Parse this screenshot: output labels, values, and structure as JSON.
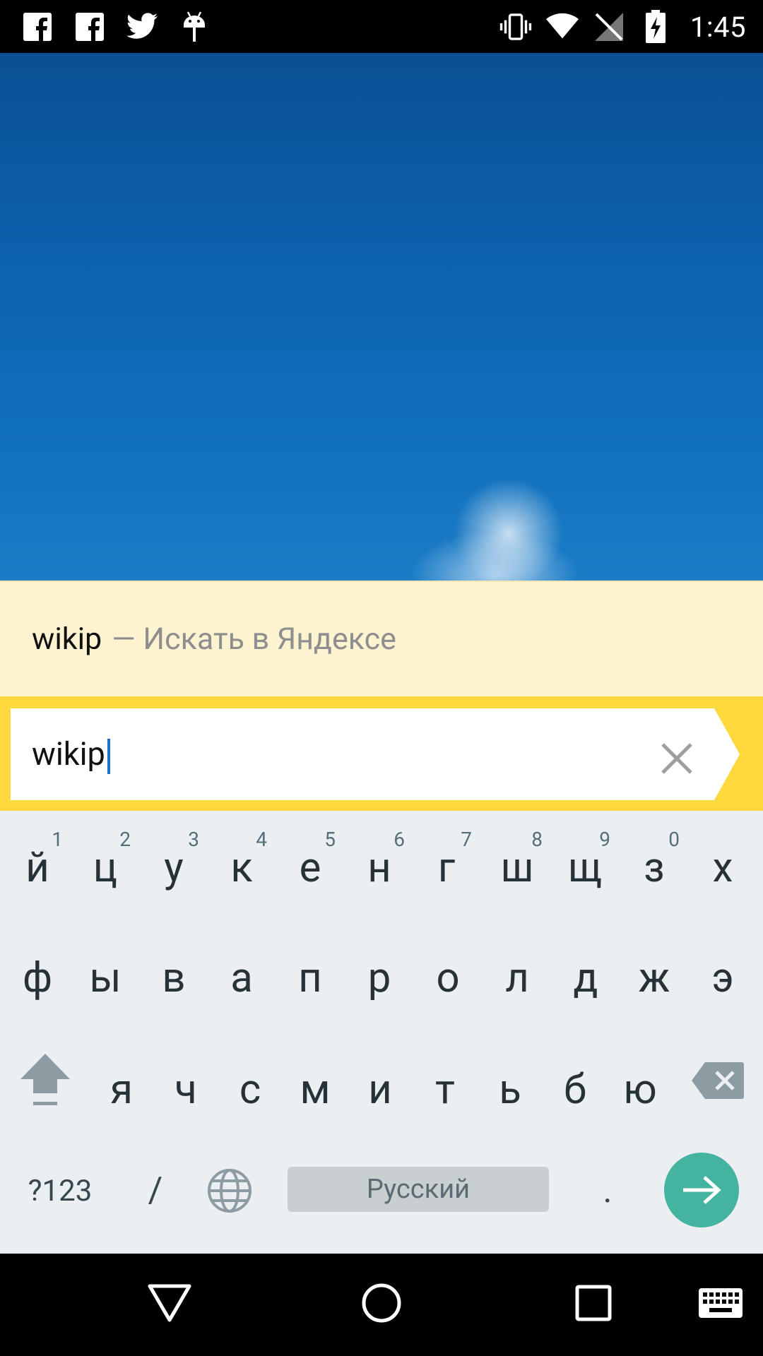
{
  "status_bar": {
    "time": "1:45",
    "left_icons": [
      "facebook-icon",
      "facebook-icon",
      "twitter-icon",
      "android-icon"
    ],
    "right_icons": [
      "vibrate-icon",
      "wifi-icon",
      "no-signal-icon",
      "battery-charging-icon"
    ]
  },
  "suggestion": {
    "query": "wikip",
    "hint": "— Искать в Яндексе"
  },
  "search": {
    "value": "wikip",
    "clear_icon": "close-icon"
  },
  "keyboard": {
    "row1": [
      {
        "ch": "й",
        "num": "1"
      },
      {
        "ch": "ц",
        "num": "2"
      },
      {
        "ch": "у",
        "num": "3"
      },
      {
        "ch": "к",
        "num": "4"
      },
      {
        "ch": "е",
        "num": "5"
      },
      {
        "ch": "н",
        "num": "6"
      },
      {
        "ch": "г",
        "num": "7"
      },
      {
        "ch": "ш",
        "num": "8"
      },
      {
        "ch": "щ",
        "num": "9"
      },
      {
        "ch": "з",
        "num": "0"
      },
      {
        "ch": "х",
        "num": ""
      }
    ],
    "row2": [
      "ф",
      "ы",
      "в",
      "а",
      "п",
      "р",
      "о",
      "л",
      "д",
      "ж",
      "э"
    ],
    "row3": [
      "я",
      "ч",
      "с",
      "м",
      "и",
      "т",
      "ь",
      "б",
      "ю"
    ],
    "symbols_label": "?123",
    "slash_label": "/",
    "space_label": "Русский",
    "period_label": ".",
    "shift_icon": "shift-icon",
    "backspace_icon": "backspace-icon",
    "globe_icon": "globe-icon",
    "enter_icon": "arrow-right-icon"
  },
  "nav_bar": {
    "buttons": [
      "back-icon",
      "home-icon",
      "recents-icon",
      "keyboard-icon"
    ]
  },
  "colors": {
    "suggestion_bg": "#fdf3d1",
    "search_accent": "#fdd93e",
    "keyboard_bg": "#eceff1",
    "enter_key": "#44b39f"
  }
}
